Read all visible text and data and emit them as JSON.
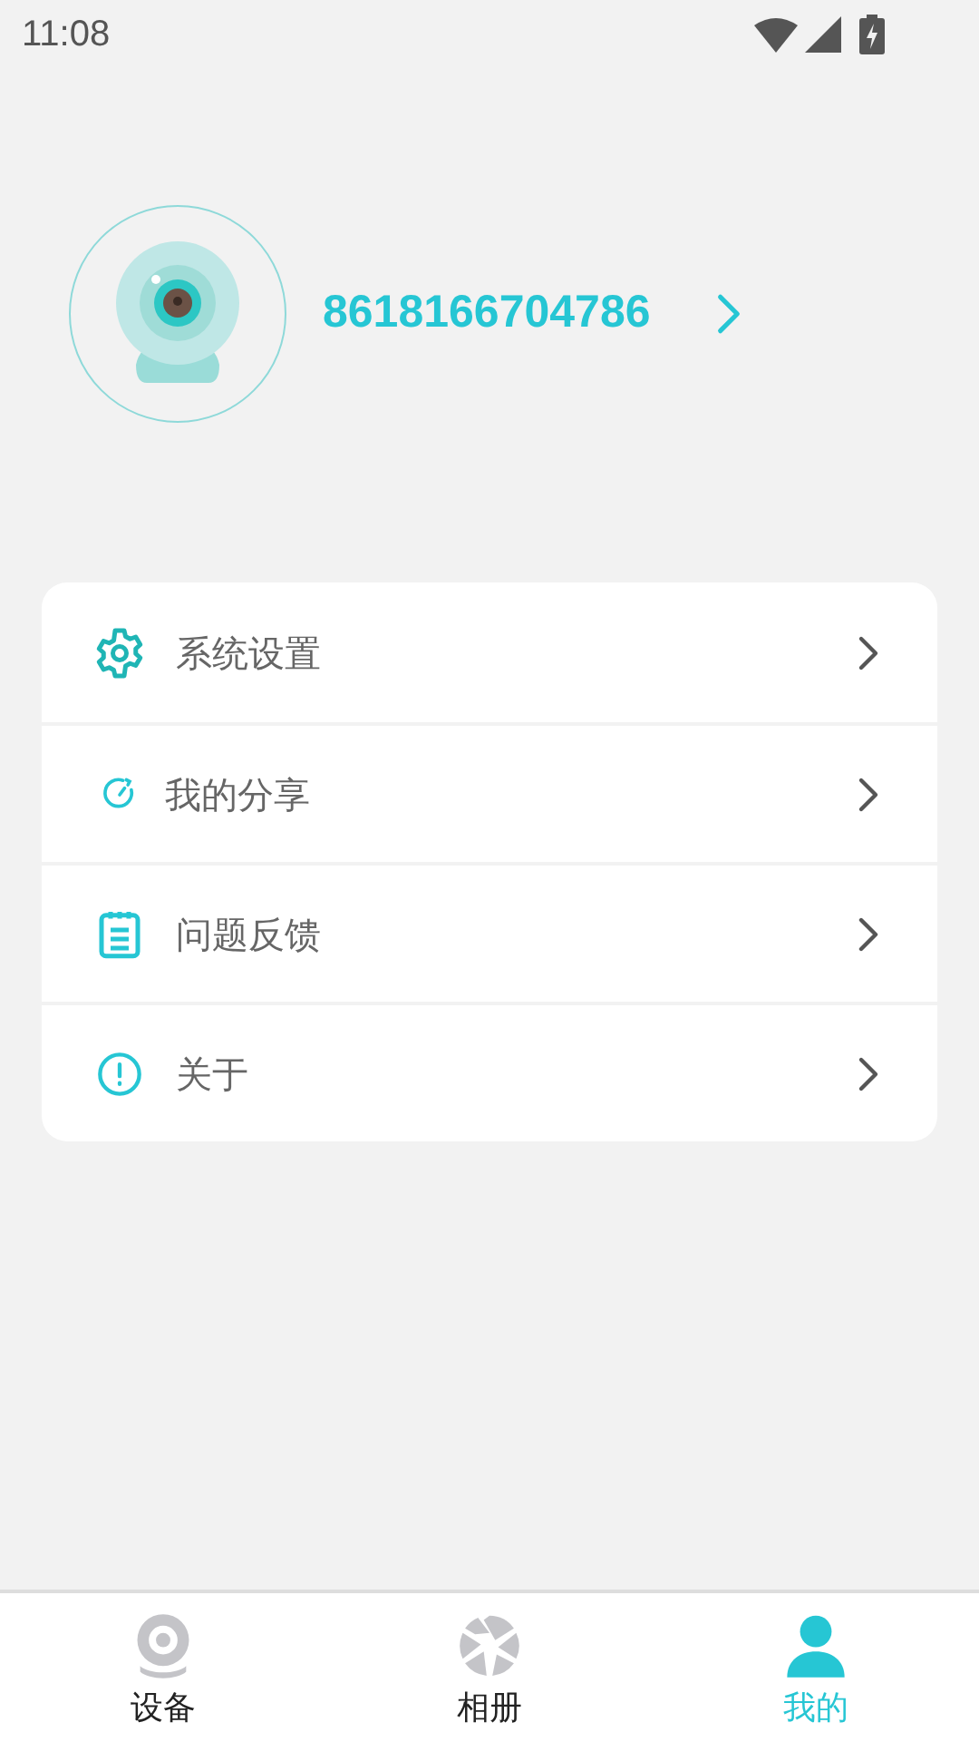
{
  "status_bar": {
    "time": "11:08"
  },
  "profile": {
    "account": "8618166704786"
  },
  "menu": [
    {
      "kind": "settings",
      "label": "系统设置"
    },
    {
      "kind": "share",
      "label": "我的分享"
    },
    {
      "kind": "feedback",
      "label": "问题反馈"
    },
    {
      "kind": "about",
      "label": "关于"
    }
  ],
  "tabs": [
    {
      "kind": "devices",
      "label": "设备",
      "selected": false
    },
    {
      "kind": "album",
      "label": "相册",
      "selected": false
    },
    {
      "kind": "me",
      "label": "我的",
      "selected": true
    }
  ]
}
